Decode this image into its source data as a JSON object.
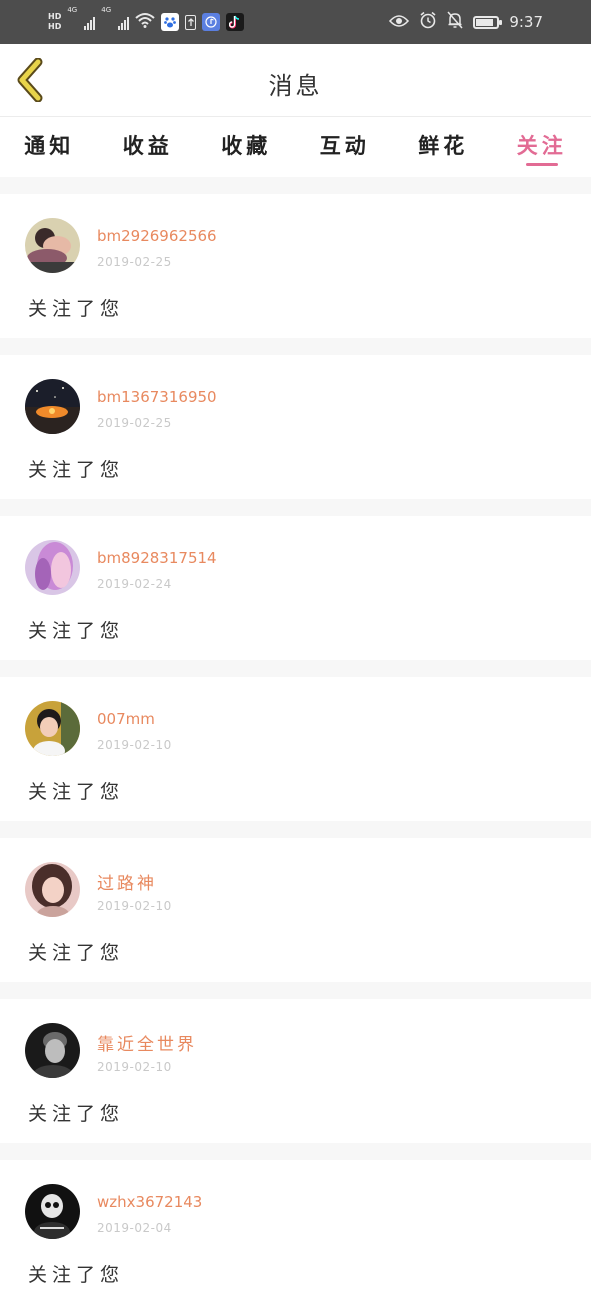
{
  "status_bar": {
    "hd1": "HD",
    "hd2": "HD",
    "net1": "4G",
    "net2": "4G",
    "time": "9:37",
    "battery_level": 0.85,
    "icons": [
      "signal-icon",
      "wifi-icon",
      "baidu-app-icon",
      "upload-icon",
      "music-app-icon",
      "tiktok-app-icon",
      "eye-icon",
      "alarm-icon",
      "notification-off-icon",
      "battery-icon"
    ]
  },
  "header": {
    "title": "消息",
    "back_icon": "chevron-left-icon"
  },
  "tabs": [
    {
      "label": "通知",
      "active": false
    },
    {
      "label": "收益",
      "active": false
    },
    {
      "label": "收藏",
      "active": false
    },
    {
      "label": "互动",
      "active": false
    },
    {
      "label": "鲜花",
      "active": false
    },
    {
      "label": "关注",
      "active": true
    }
  ],
  "colors": {
    "accent": "#e26b94",
    "username": "#e8895f",
    "date": "#c9c9c9",
    "back_icon": "#e8d44a",
    "status_bar": "#4d4d4d"
  },
  "messages": [
    {
      "username": "bm2926962566",
      "date": "2019-02-25",
      "text": "关注了您",
      "avatar": "avatar-couple-photo"
    },
    {
      "username": "bm1367316950",
      "date": "2019-02-25",
      "text": "关注了您",
      "avatar": "avatar-sunset-photo"
    },
    {
      "username": "bm8928317514",
      "date": "2019-02-24",
      "text": "关注了您",
      "avatar": "avatar-pink-hair-photo"
    },
    {
      "username": "007mm",
      "date": "2019-02-10",
      "text": "关注了您",
      "avatar": "avatar-child-photo"
    },
    {
      "username": "过路神",
      "date": "2019-02-10",
      "text": "关注了您",
      "avatar": "avatar-girl-photo"
    },
    {
      "username": "靠近全世界",
      "date": "2019-02-10",
      "text": "关注了您",
      "avatar": "avatar-bw-man-photo"
    },
    {
      "username": "wzhx3672143",
      "date": "2019-02-04",
      "text": "关注了您",
      "avatar": "avatar-skull-photo"
    }
  ]
}
